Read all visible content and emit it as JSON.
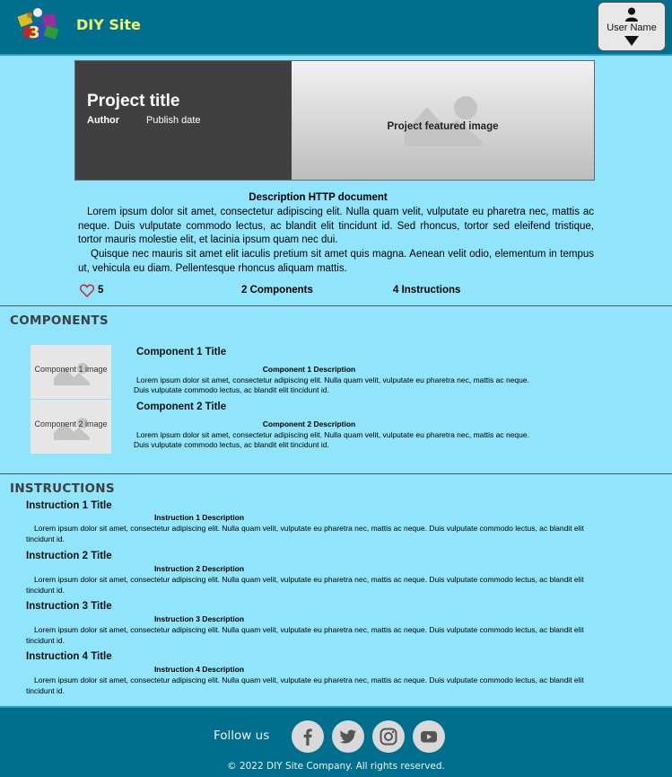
{
  "header": {
    "site_name": "DIY Site",
    "user_name": "User Name"
  },
  "project": {
    "title": "Project title",
    "author": "Author",
    "publish_date": "Publish date",
    "featured_image_label": "Project featured image",
    "description_title": "Description HTTP document",
    "description_paragraphs": [
      "Lorem ipsum dolor sit amet, consectetur adipiscing elit. Nulla quam velit, vulputate eu pharetra nec, mattis ac neque. Duis vulputate commodo lectus, ac blandit elit tincidunt id. Sed rhoncus, tortor sed eleifend tristique, tortor mauris molestie elit, et lacinia ipsum quam nec dui.",
      "Quisque nec mauris sit amet elit iaculis pretium sit amet quis magna. Aenean velit odio, elementum in tempus ut, vehicula eu diam. Pellentesque rhoncus aliquam mattis."
    ],
    "likes": "5",
    "components_count": "2 Components",
    "instructions_count": "4 Instructions"
  },
  "components": {
    "heading": "COMPONENTS",
    "items": [
      {
        "image_label": "Component 1 image",
        "title": "Component 1 Title",
        "description_title": "Component 1 Description",
        "description": "Lorem ipsum dolor sit amet, consectetur adipiscing elit. Nulla quam velit, vulputate eu pharetra nec, mattis ac neque. Duis vulputate commodo lectus, ac blandit elit tincidunt id."
      },
      {
        "image_label": "Component 2 image",
        "title": "Component 2 Title",
        "description_title": "Component 2 Description",
        "description": "Lorem ipsum dolor sit amet, consectetur adipiscing elit. Nulla quam velit, vulputate eu pharetra nec, mattis ac neque. Duis vulputate commodo lectus, ac blandit elit tincidunt id."
      }
    ]
  },
  "instructions": {
    "heading": "INSTRUCTIONS",
    "items": [
      {
        "title": "Instruction 1 Title",
        "description_title": "Instruction 1 Description",
        "description": "Lorem ipsum dolor sit amet, consectetur adipiscing elit. Nulla quam velit, vulputate eu pharetra nec, mattis ac neque. Duis vulputate commodo lectus, ac blandit elit tincidunt id."
      },
      {
        "title": "Instruction 2 Title",
        "description_title": "Instruction 2 Description",
        "description": "Lorem ipsum dolor sit amet, consectetur adipiscing elit. Nulla quam velit, vulputate eu pharetra nec, mattis ac neque. Duis vulputate commodo lectus, ac blandit elit tincidunt id."
      },
      {
        "title": "Instruction 3 Title",
        "description_title": "Instruction 3 Description",
        "description": "Lorem ipsum dolor sit amet, consectetur adipiscing elit. Nulla quam velit, vulputate eu pharetra nec, mattis ac neque. Duis vulputate commodo lectus, ac blandit elit tincidunt id."
      },
      {
        "title": "Instruction 4 Title",
        "description_title": "Instruction 4 Description",
        "description": "Lorem ipsum dolor sit amet, consectetur adipiscing elit. Nulla quam velit, vulputate eu pharetra nec, mattis ac neque. Duis vulputate commodo lectus, ac blandit elit tincidunt id."
      }
    ]
  },
  "footer": {
    "follow_label": "Follow us",
    "social_icons": [
      "facebook-icon",
      "twitter-icon",
      "instagram-icon",
      "youtube-icon"
    ],
    "copyright": "© 2022 DIY Site Company.  All rights reserved."
  },
  "colors": {
    "header_bg": "#006f8e",
    "page_bg": "#90e4fb",
    "site_name": "#f2f36a",
    "hero_panel": "#404040"
  }
}
